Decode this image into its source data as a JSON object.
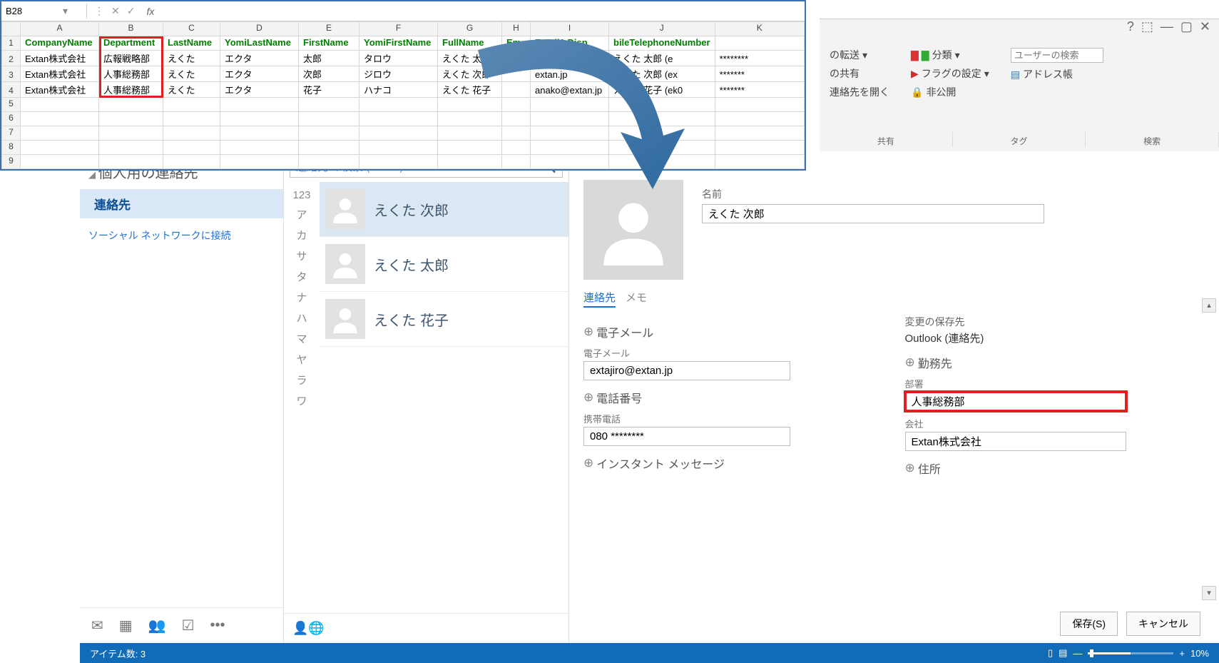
{
  "excel": {
    "namebox": "B28",
    "headers": [
      "",
      "A",
      "B",
      "C",
      "D",
      "E",
      "F",
      "G",
      "H",
      "I",
      "J",
      "K"
    ],
    "data_headers": [
      "CompanyName",
      "Department",
      "LastName",
      "YomiLastName",
      "FirstName",
      "YomiFirstName",
      "FullName",
      "Em",
      "Email1 Disp",
      "bileTelephoneNumber"
    ],
    "rows": [
      [
        "Extan株式会社",
        "広報戦略部",
        "えくた",
        "エクタ",
        "太郎",
        "タロウ",
        "えくた 太郎",
        "",
        "extan.jp",
        "えくた 太郎 (e",
        "********"
      ],
      [
        "Extan株式会社",
        "人事総務部",
        "えくた",
        "エクタ",
        "次郎",
        "ジロウ",
        "えくた 次郎",
        "",
        "extan.jp",
        "えくた 次郎 (ex",
        "*******"
      ],
      [
        "Extan株式会社",
        "人事総務部",
        "えくた",
        "エクタ",
        "花子",
        "ハナコ",
        "えくた 花子",
        "",
        "anako@extan.jp",
        "えくた 花子 (ek0",
        "*******"
      ]
    ],
    "empty_rows": [
      "5",
      "6",
      "7",
      "8",
      "9"
    ]
  },
  "ribbon": {
    "forward": "の転送",
    "share": "の共有",
    "open": "連絡先を開く",
    "shareGroup": "共有",
    "category": "分類",
    "flag": "フラグの設定",
    "private": "非公開",
    "tagGroup": "タグ",
    "userSearch": "ユーザーの検索",
    "addressBook": "アドレス帳",
    "searchGroup": "検索"
  },
  "sidebar": {
    "title": "個人用の連絡先",
    "selected": "連絡先",
    "social": "ソーシャル ネットワークに接続"
  },
  "list": {
    "searchPlaceholder": "連絡先 の検索 (Ctrl+E)",
    "kana": [
      "123",
      "ア",
      "カ",
      "サ",
      "タ",
      "ナ",
      "ハ",
      "マ",
      "ヤ",
      "ラ",
      "ワ"
    ],
    "contacts": [
      "えくた 次郎",
      "えくた 太郎",
      "えくた 花子"
    ]
  },
  "detail": {
    "nameLabel": "名前",
    "nameValue": "えくた 次郎",
    "tabContact": "連絡先",
    "tabMemo": "メモ",
    "emailSection": "電子メール",
    "emailLabel": "電子メール",
    "emailValue": "extajiro@extan.jp",
    "phoneSection": "電話番号",
    "phoneLabel": "携帯電話",
    "phoneValue": "080 ********",
    "imSection": "インスタント メッセージ",
    "saveDestLabel": "変更の保存先",
    "saveDestValue": "Outlook (連絡先)",
    "workSection": "勤務先",
    "deptLabel": "部署",
    "deptValue": "人事総務部",
    "companyLabel": "会社",
    "companyValue": "Extan株式会社",
    "addressSection": "住所",
    "saveBtn": "保存(S)",
    "cancelBtn": "キャンセル"
  },
  "status": {
    "items": "アイテム数:  3",
    "zoom": "10%"
  }
}
